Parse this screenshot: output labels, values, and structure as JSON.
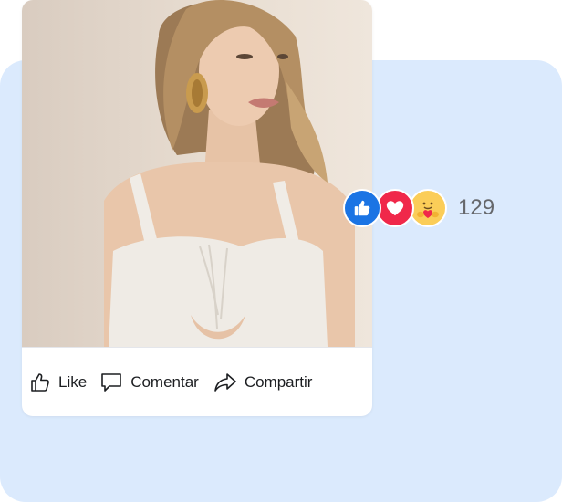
{
  "post": {
    "actions": {
      "like_label": "Like",
      "comment_label": "Comentar",
      "share_label": "Compartir"
    },
    "reactions": {
      "types": [
        "like",
        "love",
        "care"
      ],
      "count": "129"
    }
  },
  "colors": {
    "panel_background": "#dbeafd",
    "like_blue": "#1b74e4",
    "love_red": "#f0284a",
    "care_yellow": "#fbcd58",
    "text_secondary": "#65676b"
  },
  "icons": [
    "thumbs-up-icon",
    "comment-icon",
    "share-icon",
    "like-reaction-icon",
    "love-reaction-icon",
    "care-reaction-icon"
  ]
}
